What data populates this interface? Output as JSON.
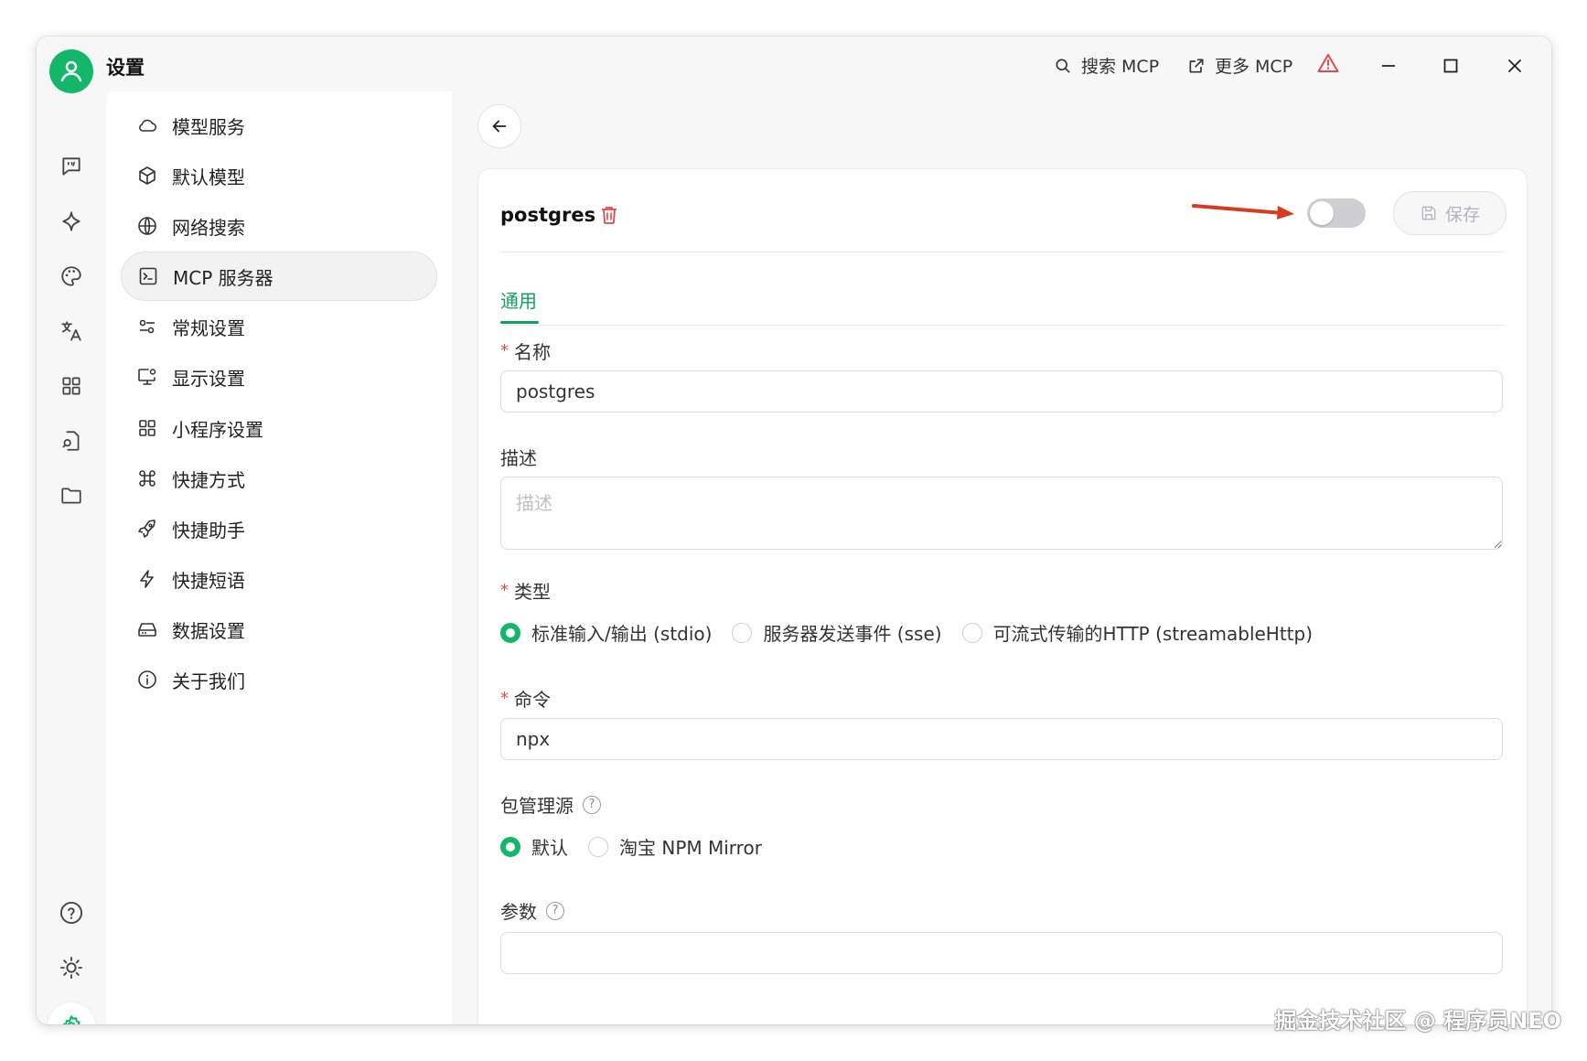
{
  "window": {
    "title": "设置"
  },
  "titlebar": {
    "search_label": "搜索 MCP",
    "more_label": "更多 MCP"
  },
  "menu": {
    "items": [
      {
        "label": "模型服务",
        "icon": "cloud-icon"
      },
      {
        "label": "默认模型",
        "icon": "cube-icon"
      },
      {
        "label": "网络搜索",
        "icon": "globe-icon"
      },
      {
        "label": "MCP 服务器",
        "icon": "terminal-icon",
        "active": true
      },
      {
        "label": "常规设置",
        "icon": "sliders-icon"
      },
      {
        "label": "显示设置",
        "icon": "monitor-settings-icon"
      },
      {
        "label": "小程序设置",
        "icon": "grid-icon"
      },
      {
        "label": "快捷方式",
        "icon": "command-icon"
      },
      {
        "label": "快捷助手",
        "icon": "rocket-icon"
      },
      {
        "label": "快捷短语",
        "icon": "zap-icon"
      },
      {
        "label": "数据设置",
        "icon": "hard-drive-icon"
      },
      {
        "label": "关于我们",
        "icon": "info-icon"
      }
    ]
  },
  "server": {
    "name": "postgres",
    "enabled": false,
    "save_label": "保存"
  },
  "tabs": [
    {
      "label": "通用",
      "active": true
    }
  ],
  "form": {
    "name_label": "名称",
    "name_value": "postgres",
    "desc_label": "描述",
    "desc_placeholder": "描述",
    "type_label": "类型",
    "type_options": [
      {
        "label": "标准输入/输出 (stdio)",
        "checked": true
      },
      {
        "label": "服务器发送事件 (sse)",
        "checked": false
      },
      {
        "label": "可流式传输的HTTP (streamableHttp)",
        "checked": false
      }
    ],
    "command_label": "命令",
    "command_value": "npx",
    "registry_label": "包管理源",
    "registry_options": [
      {
        "label": "默认",
        "checked": true
      },
      {
        "label": "淘宝 NPM Mirror",
        "checked": false
      }
    ],
    "args_label": "参数"
  },
  "watermark": "掘金技术社区 @ 程序员NEO",
  "colors": {
    "accent": "#12b76a",
    "danger": "#e5484d",
    "arrow": "#d93a1f"
  }
}
